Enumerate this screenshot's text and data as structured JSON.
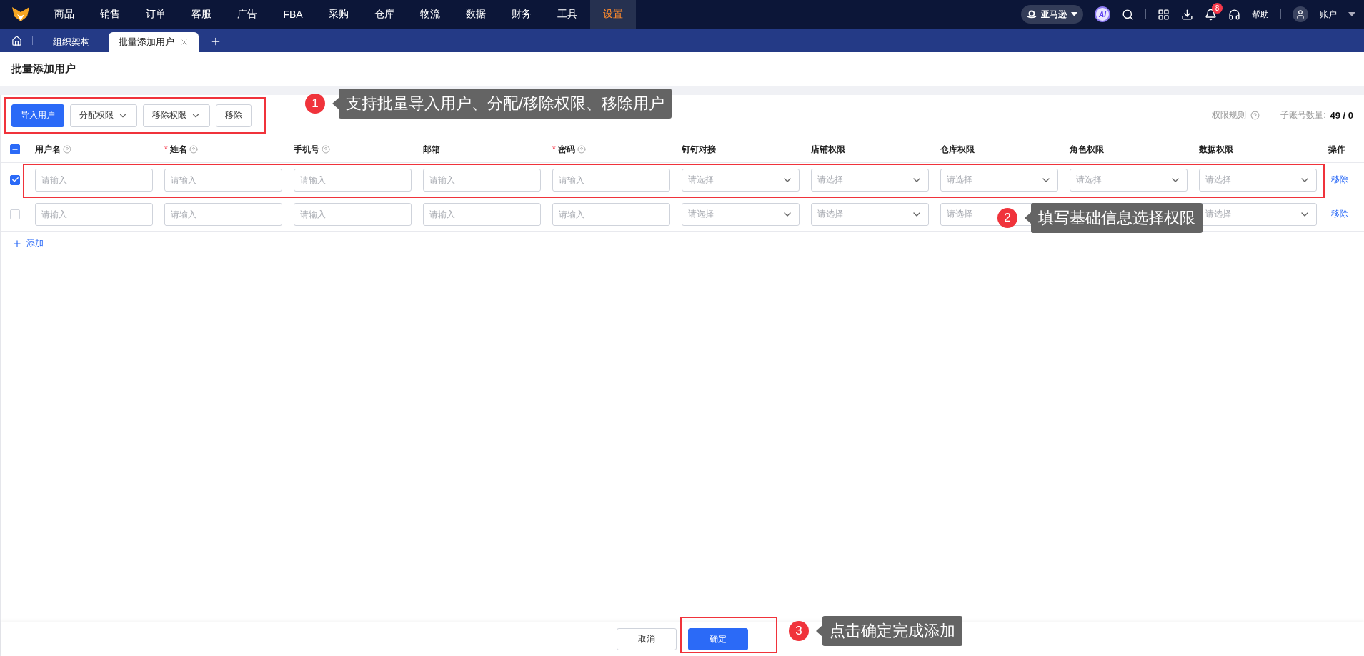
{
  "nav": {
    "items": [
      {
        "label": "商品",
        "selected": false
      },
      {
        "label": "销售",
        "selected": false
      },
      {
        "label": "订单",
        "selected": false
      },
      {
        "label": "客服",
        "selected": false
      },
      {
        "label": "广告",
        "selected": false
      },
      {
        "label": "FBA",
        "selected": false
      },
      {
        "label": "采购",
        "selected": false
      },
      {
        "label": "仓库",
        "selected": false
      },
      {
        "label": "物流",
        "selected": false
      },
      {
        "label": "数据",
        "selected": false
      },
      {
        "label": "财务",
        "selected": false
      },
      {
        "label": "工具",
        "selected": false
      },
      {
        "label": "设置",
        "selected": true
      }
    ],
    "marketplace": "亚马逊",
    "ai": "AI",
    "notifications": "8",
    "help": "帮助",
    "account": "账户"
  },
  "tabs": [
    {
      "label": "组织架构",
      "selected": false,
      "closable": false
    },
    {
      "label": "批量添加用户",
      "selected": true,
      "closable": true
    }
  ],
  "page_title": "批量添加用户",
  "toolbar": {
    "buttons": [
      {
        "label": "导入用户",
        "kind": "primary"
      },
      {
        "label": "分配权限",
        "kind": "dropdown"
      },
      {
        "label": "移除权限",
        "kind": "dropdown"
      },
      {
        "label": "移除",
        "kind": "plain"
      }
    ],
    "rules_link": "权限规则",
    "quota_label": "子账号数量:",
    "quota_value": "49 / 0"
  },
  "table": {
    "indeterminate": true,
    "columns": [
      {
        "label": "用户名",
        "required": false,
        "help": true
      },
      {
        "required_mark": "*",
        "label": "姓名",
        "required": true,
        "help": true
      },
      {
        "label": "手机号",
        "required": false,
        "help": true
      },
      {
        "label": "邮箱",
        "required": false,
        "help": false
      },
      {
        "required_mark": "*",
        "label": "密码",
        "required": true,
        "help": true
      },
      {
        "label": "钉钉对接",
        "required": false,
        "help": false
      },
      {
        "label": "店铺权限",
        "required": false,
        "help": false
      },
      {
        "label": "仓库权限",
        "required": false,
        "help": false
      },
      {
        "label": "角色权限",
        "required": false,
        "help": false
      },
      {
        "label": "数据权限",
        "required": false,
        "help": false
      }
    ],
    "action_column": "操作",
    "rows": [
      {
        "selected": true,
        "action": "移除",
        "cells": [
          {
            "kind": "input",
            "placeholder": "请输入"
          },
          {
            "kind": "input",
            "placeholder": "请输入"
          },
          {
            "kind": "input",
            "placeholder": "请输入"
          },
          {
            "kind": "input",
            "placeholder": "请输入"
          },
          {
            "kind": "input",
            "placeholder": "请输入"
          },
          {
            "kind": "select",
            "placeholder": "请选择"
          },
          {
            "kind": "select",
            "placeholder": "请选择"
          },
          {
            "kind": "select",
            "placeholder": "请选择"
          },
          {
            "kind": "select",
            "placeholder": "请选择"
          },
          {
            "kind": "select",
            "placeholder": "请选择"
          }
        ]
      },
      {
        "selected": false,
        "action": "移除",
        "cells": [
          {
            "kind": "input",
            "placeholder": "请输入"
          },
          {
            "kind": "input",
            "placeholder": "请输入"
          },
          {
            "kind": "input",
            "placeholder": "请输入"
          },
          {
            "kind": "input",
            "placeholder": "请输入"
          },
          {
            "kind": "input",
            "placeholder": "请输入"
          },
          {
            "kind": "select",
            "placeholder": "请选择"
          },
          {
            "kind": "select",
            "placeholder": "请选择"
          },
          {
            "kind": "select",
            "placeholder": "请选择"
          },
          {
            "kind": "covered"
          },
          {
            "kind": "select",
            "placeholder": "请选择"
          }
        ]
      }
    ]
  },
  "add": "添加",
  "footer": {
    "cancel": "取消",
    "confirm": "确定"
  },
  "annotations": [
    {
      "number": "1",
      "text": "支持批量导入用户、分配/移除权限、移除用户"
    },
    {
      "number": "2",
      "text": "填写基础信息选择权限"
    },
    {
      "number": "3",
      "text": "点击确定完成添加"
    }
  ]
}
